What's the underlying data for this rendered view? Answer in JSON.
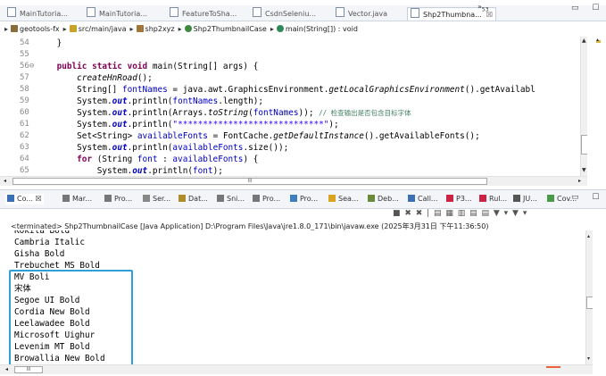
{
  "editor_tabs": [
    {
      "label": "MainTutoria...",
      "active": false
    },
    {
      "label": "MainTutoria...",
      "active": false
    },
    {
      "label": "FeatureToSha...",
      "active": false
    },
    {
      "label": "CsdnSeleniu...",
      "active": false
    },
    {
      "label": "Vector.java",
      "active": false
    },
    {
      "label": "Shp2Thumbna...",
      "active": true
    }
  ],
  "active_tab_close": "☒",
  "tab_overflow": {
    "symbol": "»",
    "count": "53"
  },
  "window_controls": "▭ ☐",
  "breadcrumb": [
    "geotools-fx",
    "src/main/java",
    "shp2xyz",
    "Shp2ThumbnailCase",
    "main(String[]) : void"
  ],
  "code_lines": [
    {
      "n": "54",
      "segs": [
        [
          "",
          "    }"
        ]
      ]
    },
    {
      "n": "55",
      "segs": [
        [
          "",
          ""
        ]
      ]
    },
    {
      "n": "56⊖",
      "segs": [
        [
          "kw",
          "    public static void "
        ],
        [
          "",
          "main(String[] args) {"
        ]
      ]
    },
    {
      "n": "57",
      "segs": [
        [
          "it",
          "        createHnRoad"
        ],
        [
          "",
          "();"
        ]
      ]
    },
    {
      "n": "58",
      "segs": [
        [
          "",
          "        String[] "
        ],
        [
          "fld",
          "fontNames"
        ],
        [
          "",
          " = java.awt.GraphicsEnvironment."
        ],
        [
          "it",
          "getLocalGraphicsEnvironment"
        ],
        [
          "",
          "().getAvailabl"
        ]
      ]
    },
    {
      "n": "59",
      "segs": [
        [
          "",
          "        System."
        ],
        [
          "fldb",
          "out"
        ],
        [
          "",
          ".println("
        ],
        [
          "fld",
          "fontNames"
        ],
        [
          "",
          ".length);"
        ]
      ]
    },
    {
      "n": "60",
      "segs": [
        [
          "",
          "        System."
        ],
        [
          "fldb",
          "out"
        ],
        [
          "",
          ".println(Arrays."
        ],
        [
          "it",
          "toString"
        ],
        [
          "",
          "("
        ],
        [
          "fld",
          "fontNames"
        ],
        [
          "",
          ")); "
        ],
        [
          "cmt",
          "// 检查输出是否包含目标字体"
        ]
      ]
    },
    {
      "n": "61",
      "segs": [
        [
          "",
          "        System."
        ],
        [
          "fldb",
          "out"
        ],
        [
          "",
          ".println("
        ],
        [
          "str",
          "\"*****************************\""
        ],
        [
          "",
          ");"
        ]
      ]
    },
    {
      "n": "62",
      "segs": [
        [
          "",
          "        Set<String> "
        ],
        [
          "fld",
          "availableFonts"
        ],
        [
          "",
          " = FontCache."
        ],
        [
          "it",
          "getDefaultInstance"
        ],
        [
          "",
          "().getAvailableFonts();"
        ]
      ]
    },
    {
      "n": "63",
      "segs": [
        [
          "",
          "        System."
        ],
        [
          "fldb",
          "out"
        ],
        [
          "",
          ".println("
        ],
        [
          "fld",
          "availableFonts"
        ],
        [
          "",
          ".size());"
        ]
      ]
    },
    {
      "n": "64",
      "segs": [
        [
          "kw",
          "        for "
        ],
        [
          "",
          "(String "
        ],
        [
          "fld",
          "font"
        ],
        [
          "",
          " : "
        ],
        [
          "fld",
          "availableFonts"
        ],
        [
          "",
          ") {"
        ]
      ]
    },
    {
      "n": "65",
      "segs": [
        [
          "",
          "            System."
        ],
        [
          "fldb",
          "out"
        ],
        [
          "",
          ".println("
        ],
        [
          "fld",
          "font"
        ],
        [
          "",
          ");"
        ]
      ]
    }
  ],
  "editor_hscroll_label": "III",
  "view_tabs": [
    {
      "label": "Co... ☒",
      "color": "#3b6fb6"
    },
    {
      "label": "Mar...",
      "color": "#777777"
    },
    {
      "label": "Pro...",
      "color": "#777777"
    },
    {
      "label": "Ser...",
      "color": "#888888"
    },
    {
      "label": "Dat...",
      "color": "#b08b2a"
    },
    {
      "label": "Sni...",
      "color": "#777777"
    },
    {
      "label": "Pro...",
      "color": "#777777"
    },
    {
      "label": "Pro...",
      "color": "#3f7fbf"
    },
    {
      "label": "Sea...",
      "color": "#d9a520"
    },
    {
      "label": "Deb...",
      "color": "#6a8a3a"
    },
    {
      "label": "Call...",
      "color": "#3b6fb6"
    },
    {
      "label": "P3...",
      "color": "#cc2244"
    },
    {
      "label": "Rul...",
      "color": "#cc2244"
    },
    {
      "label": "JU...",
      "color": "#555555"
    },
    {
      "label": "Cov...",
      "color": "#4a9a4a"
    }
  ],
  "view_controls": "▭ ☐",
  "console_toolbar": "■ ✖ ✖ | ▤ ▦ ▥ ▤ ▤ ▼ ▾ ▼ ▾",
  "terminated_line": "<terminated> Shp2ThumbnailCase [Java Application] D:\\Program Files\\Java\\jre1.8.0_171\\bin\\javaw.exe (2025年3月31日 下午11:36:50)",
  "console_lines": [
    "Kokila Bold",
    "Cambria Italic",
    "Gisha Bold",
    "Trebuchet MS Bold",
    "MV Boli",
    "宋体",
    "Segoe UI Bold",
    "Cordia New Bold",
    "Leelawadee Bold",
    "Microsoft Uighur",
    "Levenim MT Bold",
    "Browallia New Bold"
  ],
  "console_hscroll_label": "III"
}
